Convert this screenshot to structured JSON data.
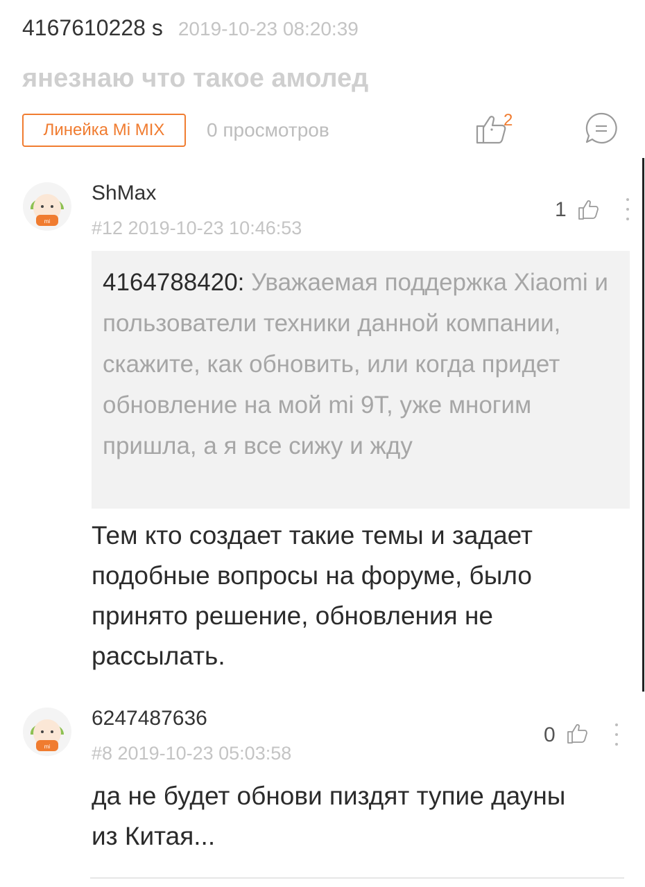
{
  "post": {
    "author_id": "4167610228 s",
    "date": "2019-10-23 08:20:39",
    "title": "янезнаю что такое амолед",
    "tag": "Линейка Mi MIX",
    "views": "0 просмотров",
    "likes": "2"
  },
  "comments": [
    {
      "name": "ShMax",
      "meta": "#12   2019-10-23 10:46:53",
      "likes": "1",
      "quote_author": "4164788420:",
      "quote_text": " Уважаемая поддержка Xiaomi и пользователи техники данной компании, скажите, как обновить, или когда придет обновление на мой mi 9T, уже многим пришла, а я все сижу и жду",
      "text": "Тем кто создает такие темы и задает подобные вопросы на форуме, было принято решение, обновления не рассылать."
    },
    {
      "name": "6247487636",
      "meta": "#8   2019-10-23 05:03:58",
      "likes": "0",
      "text": "да не будет обнови пиздят тупие дауны из Китая..."
    }
  ],
  "colors": {
    "accent": "#f07c30",
    "muted": "#c4c4c4",
    "quote_bg": "#f2f2f2"
  },
  "icons": [
    "thumbs-up-icon",
    "comment-icon",
    "more-vertical-icon",
    "avatar-mi-bunny-icon"
  ]
}
